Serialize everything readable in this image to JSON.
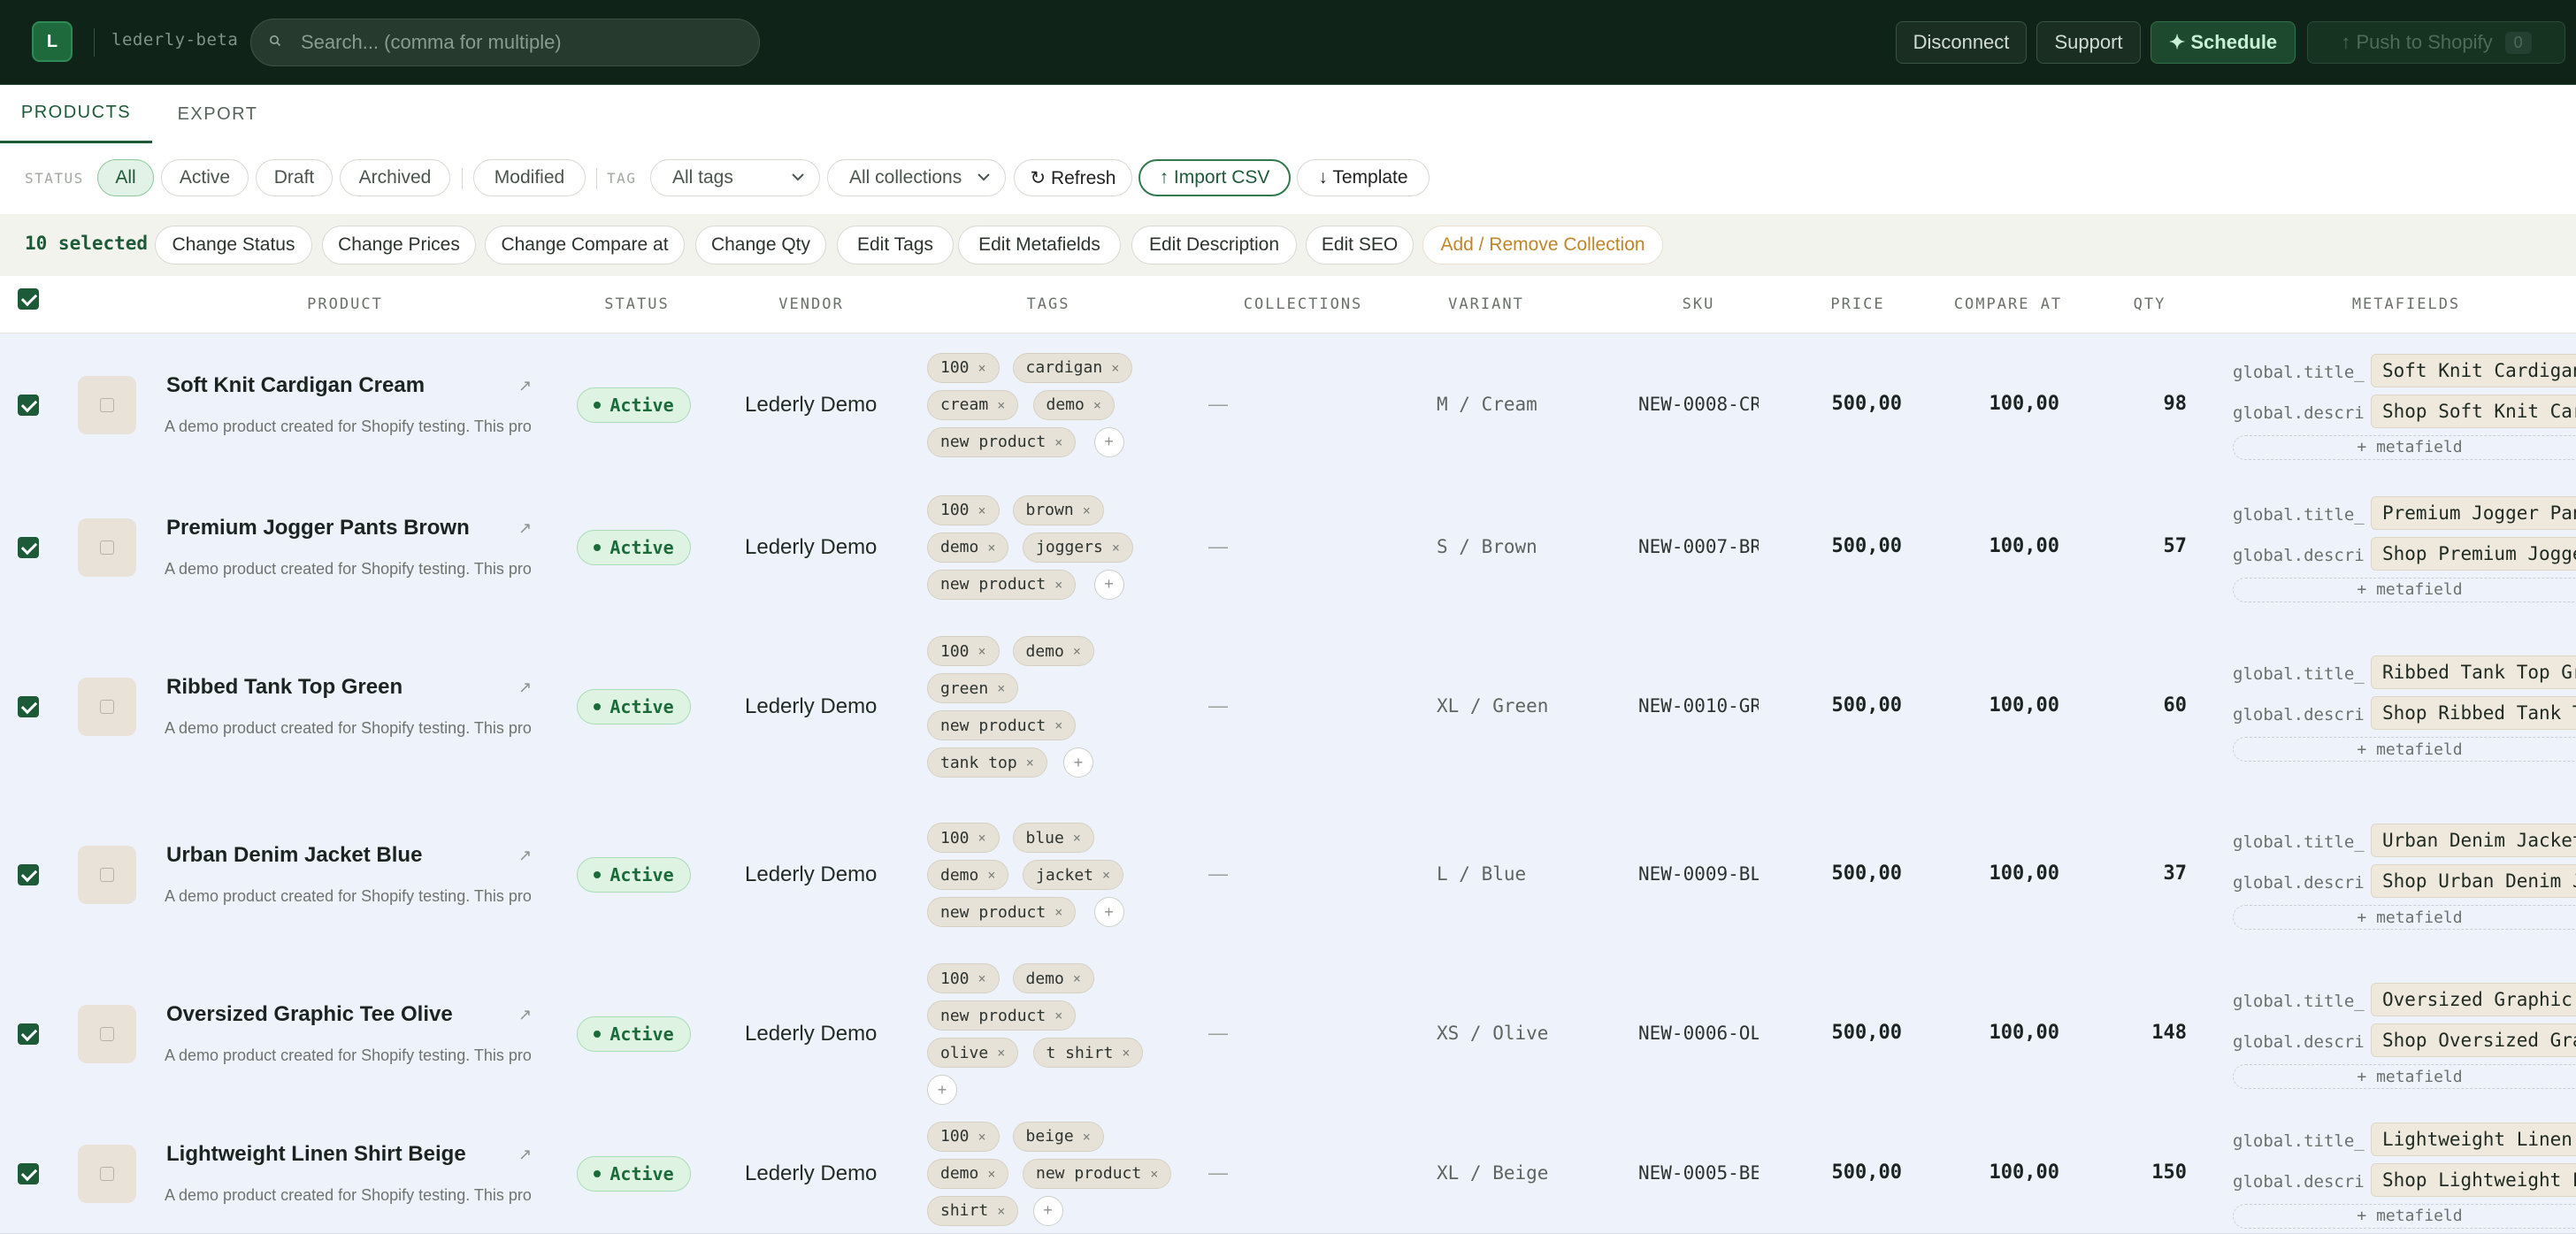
{
  "app": {
    "logo_letter": "L",
    "store_name": "lederly-beta",
    "search_placeholder": "Search... (comma for multiple)",
    "buttons": {
      "disconnect": "Disconnect",
      "support": "Support",
      "schedule": "✦ Schedule",
      "push": "↑ Push to Shopify",
      "push_count": "0"
    },
    "colors": {
      "topbar": "#0f2318",
      "accent": "#1d5a38",
      "row_bg": "#eef3fb"
    }
  },
  "tabs": [
    {
      "label": "PRODUCTS",
      "active": true
    },
    {
      "label": "EXPORT",
      "active": false
    }
  ],
  "filters": {
    "status_label": "STATUS",
    "status_options": [
      "All",
      "Active",
      "Draft",
      "Archived"
    ],
    "modified": "Modified",
    "tag_label": "TAG",
    "tags_select": "All tags",
    "collections_select": "All collections",
    "refresh": "↻ Refresh",
    "import": "↑ Import CSV",
    "template": "↓ Template"
  },
  "bulk": {
    "selected": "10 selected",
    "actions": [
      "Change Status",
      "Change Prices",
      "Change Compare at",
      "Change Qty",
      "Edit Tags",
      "Edit Metafields",
      "Edit Description",
      "Edit SEO",
      "Add / Remove Collection"
    ]
  },
  "table": {
    "headers": {
      "product": "PRODUCT",
      "status": "STATUS",
      "vendor": "VENDOR",
      "tags": "TAGS",
      "collections": "COLLECTIONS",
      "variant": "VARIANT",
      "sku": "SKU",
      "price": "PRICE",
      "compare_at": "COMPARE AT",
      "qty": "QTY",
      "metafields": "METAFIELDS"
    },
    "add_metafield": "+ metafield",
    "tag_add": "+",
    "rows": [
      {
        "name": "Soft Knit Cardigan Cream",
        "desc": "A demo product created for Shopify testing. This product is",
        "status": "Active",
        "vendor": "Lederly Demo",
        "tags": [
          "100",
          "cardigan",
          "cream",
          "demo",
          "new product"
        ],
        "collections": "—",
        "variant": "M / Cream",
        "sku": "NEW-0008-CR",
        "price": "500,00",
        "compare_at": "100,00",
        "qty": "98",
        "meta_title_key": "global.title_tag",
        "meta_title_val": "Soft Knit Cardigan Cream",
        "meta_desc_key": "global.description_tag",
        "meta_desc_val": "Shop Soft Knit Cardigan Cream"
      },
      {
        "name": "Premium Jogger Pants Brown",
        "desc": "A demo product created for Shopify testing. This product is",
        "status": "Active",
        "vendor": "Lederly Demo",
        "tags": [
          "100",
          "brown",
          "demo",
          "joggers",
          "new product"
        ],
        "collections": "—",
        "variant": "S / Brown",
        "sku": "NEW-0007-BR",
        "price": "500,00",
        "compare_at": "100,00",
        "qty": "57",
        "meta_title_key": "global.title_tag",
        "meta_title_val": "Premium Jogger Pants Brown",
        "meta_desc_key": "global.description_tag",
        "meta_desc_val": "Shop Premium Jogger Pants Brown"
      },
      {
        "name": "Ribbed Tank Top Green",
        "desc": "A demo product created for Shopify testing. This product is",
        "status": "Active",
        "vendor": "Lederly Demo",
        "tags": [
          "100",
          "demo",
          "green",
          "new product",
          "tank top"
        ],
        "collections": "—",
        "variant": "XL / Green",
        "sku": "NEW-0010-GR",
        "price": "500,00",
        "compare_at": "100,00",
        "qty": "60",
        "meta_title_key": "global.title_tag",
        "meta_title_val": "Ribbed Tank Top Green",
        "meta_desc_key": "global.description_tag",
        "meta_desc_val": "Shop Ribbed Tank Top Green"
      },
      {
        "name": "Urban Denim Jacket Blue",
        "desc": "A demo product created for Shopify testing. This product is",
        "status": "Active",
        "vendor": "Lederly Demo",
        "tags": [
          "100",
          "blue",
          "demo",
          "jacket",
          "new product"
        ],
        "collections": "—",
        "variant": "L / Blue",
        "sku": "NEW-0009-BL",
        "price": "500,00",
        "compare_at": "100,00",
        "qty": "37",
        "meta_title_key": "global.title_tag",
        "meta_title_val": "Urban Denim Jacket Blue",
        "meta_desc_key": "global.description_tag",
        "meta_desc_val": "Shop Urban Denim Jacket Blue"
      },
      {
        "name": "Oversized Graphic Tee Olive",
        "desc": "A demo product created for Shopify testing. This product is",
        "status": "Active",
        "vendor": "Lederly Demo",
        "tags": [
          "100",
          "demo",
          "new product",
          "olive",
          "t shirt"
        ],
        "collections": "—",
        "variant": "XS / Olive",
        "sku": "NEW-0006-OL",
        "price": "500,00",
        "compare_at": "100,00",
        "qty": "148",
        "meta_title_key": "global.title_tag",
        "meta_title_val": "Oversized Graphic Tee Olive",
        "meta_desc_key": "global.description_tag",
        "meta_desc_val": "Shop Oversized Graphic Tee Olive"
      },
      {
        "name": "Lightweight Linen Shirt Beige",
        "desc": "A demo product created for Shopify testing. This product is",
        "status": "Active",
        "vendor": "Lederly Demo",
        "tags": [
          "100",
          "beige",
          "demo",
          "new product",
          "shirt"
        ],
        "collections": "—",
        "variant": "XL / Beige",
        "sku": "NEW-0005-BE",
        "price": "500,00",
        "compare_at": "100,00",
        "qty": "150",
        "meta_title_key": "global.title_tag",
        "meta_title_val": "Lightweight Linen Shirt Beige",
        "meta_desc_key": "global.description_tag",
        "meta_desc_val": "Shop Lightweight Linen Shirt Beige"
      }
    ]
  }
}
